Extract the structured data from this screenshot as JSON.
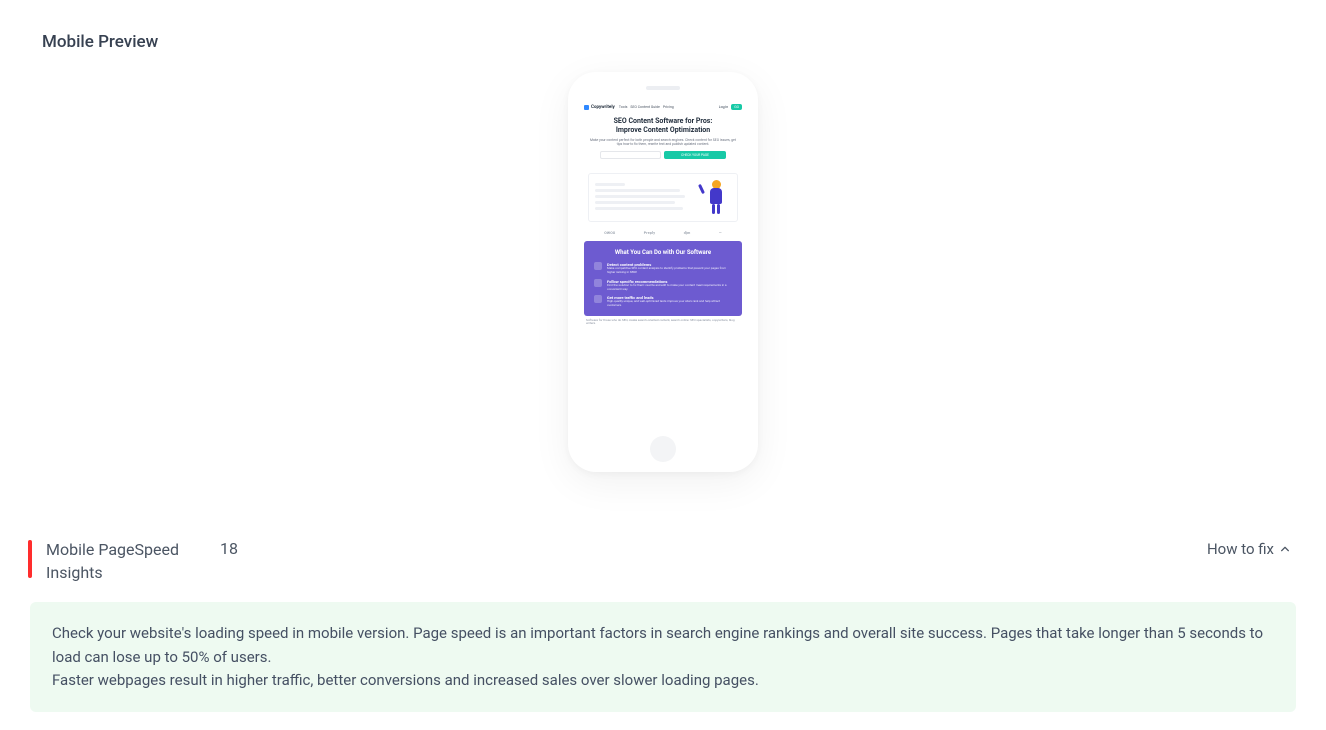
{
  "section_title": "Mobile Preview",
  "preview": {
    "nav": {
      "logo": "Copywritely",
      "links": [
        "Tools",
        "SEO Content Guide",
        "Pricing"
      ],
      "login": "Log in",
      "go": "GO"
    },
    "hero": {
      "title_l1": "SEO Content Software for Pros:",
      "title_l2": "Improve Content Optimization",
      "subtitle": "Make your content perfect for both people and search engines. Check content for SEO issues, get tips how to fix them, rewrite text and publish updated content.",
      "cta": "CHECK YOUR PAGE"
    },
    "logos": [
      "OWOX",
      "Preply",
      "djm",
      "—"
    ],
    "purple": {
      "title": "What You Can Do with Our Software",
      "items": [
        {
          "t": "Detect content problems",
          "d": "Make competitive SEO content analysis to identify problems that prevent your pages from higher ranking in SERP."
        },
        {
          "t": "Follow specific recommendations",
          "d": "Find the solution to fix them: rewrite and edit to make your content meet requirements in a convenient way."
        },
        {
          "t": "Get more traffic and leads",
          "d": "High-quality unique, and well-optimized texts improve your site's rank and help attract customers."
        }
      ]
    },
    "foot": "Software for those who do SEO, create search-oriented content, search online: SEO specialists, copywriters, blog writers."
  },
  "pagespeed": {
    "label": "Mobile PageSpeed Insights",
    "score": "18",
    "howto": "How to fix",
    "tip_p1": "Check your website's loading speed in mobile version. Page speed is an important factors in search engine rankings and overall site success. Pages that take longer than 5 seconds to load can lose up to 50% of users.",
    "tip_p2": "Faster webpages result in higher traffic, better conversions and increased sales over slower loading pages."
  }
}
